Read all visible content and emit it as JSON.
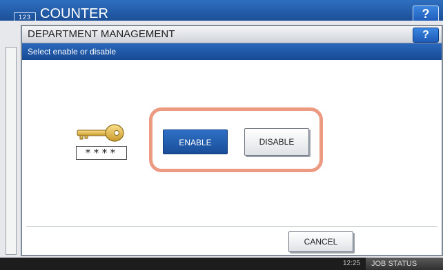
{
  "background": {
    "badge": "123",
    "title": "COUNTER",
    "help": "?",
    "time": "12:25",
    "job_status": "JOB STATUS"
  },
  "dialog": {
    "title": "DEPARTMENT MANAGEMENT",
    "help": "?",
    "subtitle": "Select enable or disable",
    "password_mask": "****",
    "buttons": {
      "enable": "ENABLE",
      "disable": "DISABLE",
      "cancel": "CANCEL"
    },
    "selected": "enable"
  },
  "colors": {
    "accent": "#1f5aa8",
    "highlight_ring": "#ec9a82"
  },
  "icons": {
    "key": "key-icon"
  }
}
